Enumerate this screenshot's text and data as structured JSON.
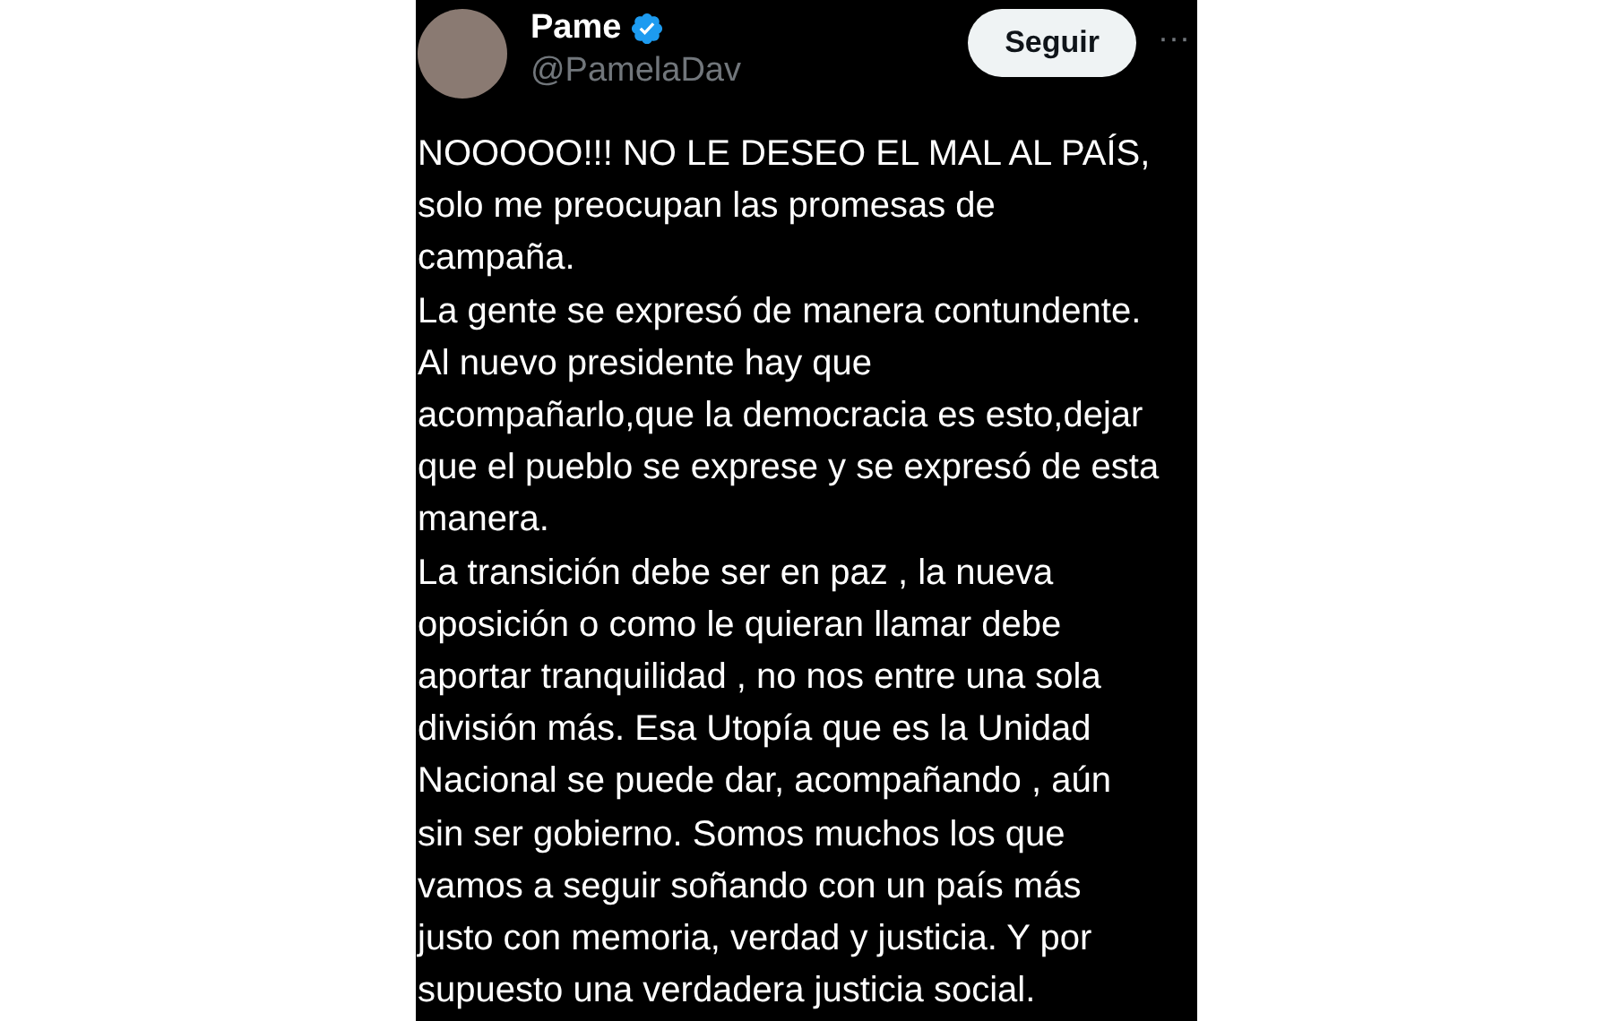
{
  "author": {
    "name": "Pame",
    "verified": true,
    "handle": "@PamelaDav"
  },
  "follow_button": "Seguir",
  "more_menu": "···",
  "text": "NOOOOO!!! NO LE DESEO EL MAL AL PAÍS,\nsolo me preocupan las promesas de\ncampaña.\nLa gente se expresó de manera contundente.\nAl nuevo presidente hay que\nacompañarlo,que la democracia es esto,dejar\nque el pueblo se exprese y se expresó de esta\nmanera.\nLa transición debe ser en paz , la nueva\noposición o como le quieran llamar debe\naportar tranquilidad , no nos entre una sola\ndivisión más. Esa Utopía que es la Unidad\nNacional se puede dar, acompañando , aún\nsin ser gobierno. Somos muchos los que\nvamos a seguir soñando con un país más\njusto con memoria, verdad y justicia. Y por\nsupuesto una verdadera justicia social."
}
